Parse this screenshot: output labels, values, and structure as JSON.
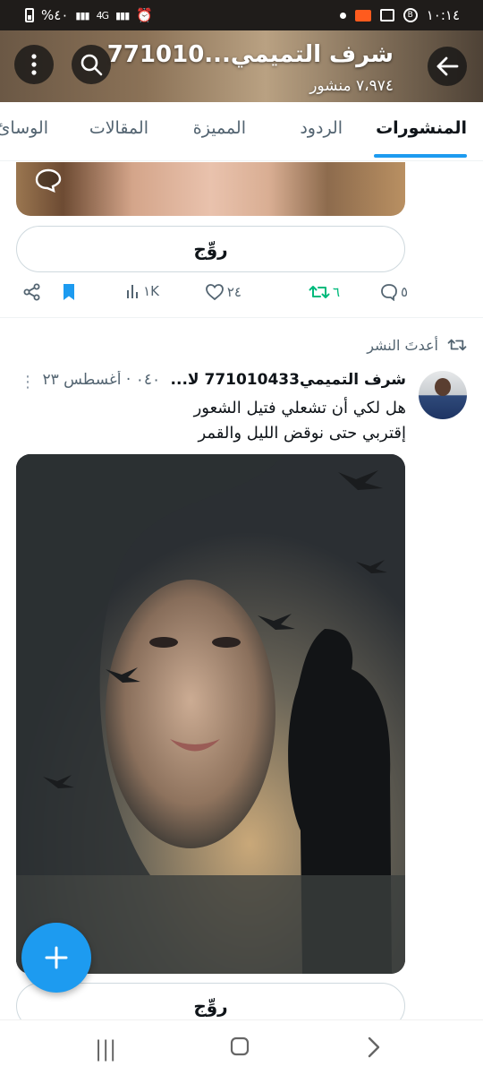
{
  "status_bar": {
    "left_battery": "%٤٠",
    "left_signal": "4G",
    "time": "١٠:١٤",
    "badge": "B"
  },
  "header": {
    "title": "شرف التميمي...771010",
    "subtitle": "٧،٩٧٤ منشور",
    "back_icon": "arrow-left-icon",
    "search_icon": "search-icon",
    "more_icon": "more-vertical-icon"
  },
  "tabs": [
    {
      "label": "المنشورات",
      "active": true
    },
    {
      "label": "الردود",
      "active": false
    },
    {
      "label": "المميزة",
      "active": false
    },
    {
      "label": "المقالات",
      "active": false
    },
    {
      "label": "الوسائ",
      "active": false
    }
  ],
  "prev_post": {
    "reply_label": "روِّج",
    "replies": "٥",
    "retweets": "٦",
    "likes": "٢٤",
    "views": "١K",
    "colors": {
      "retweet": "#00ba7c",
      "bookmark": "#1d9bf0"
    }
  },
  "post": {
    "pinned_label": "أعدتَ النشر",
    "author": "شرف التميمي771010433 لا...",
    "meta": "٠٤٠ · أغسطس ٢٣",
    "text_line1": "هل لكي أن تشعلي فتيل الشعور",
    "text_line2": "إقتربي حتى نوقض الليل والقمر",
    "reply_label": "روِّج"
  },
  "fab": {
    "icon": "plus-icon"
  },
  "accent": "#1d9bf0"
}
